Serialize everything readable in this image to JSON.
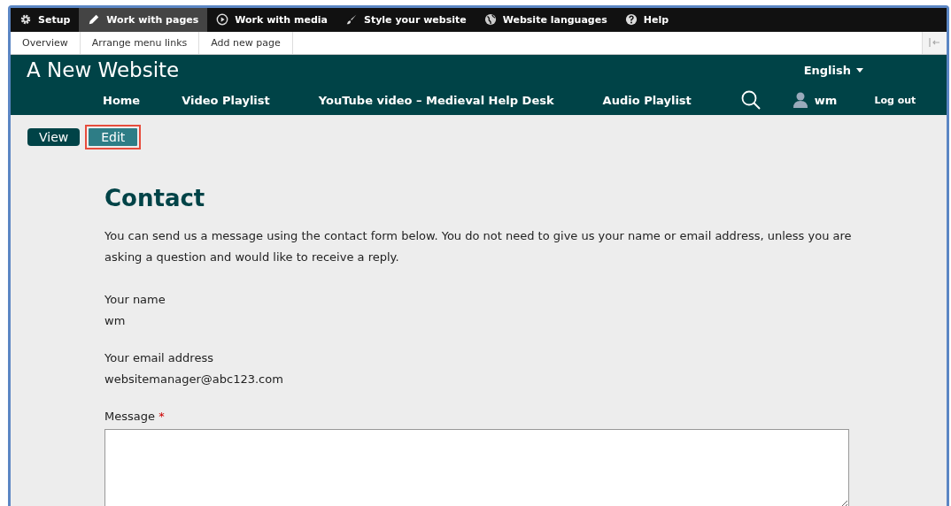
{
  "toolbar": {
    "items": [
      {
        "label": "Setup",
        "kind": "gear",
        "selected": false
      },
      {
        "label": "Work with pages",
        "kind": "pencil",
        "selected": true
      },
      {
        "label": "Work with media",
        "kind": "play",
        "selected": false
      },
      {
        "label": "Style your website",
        "kind": "brush",
        "selected": false
      },
      {
        "label": "Website languages",
        "kind": "globe",
        "selected": false
      },
      {
        "label": "Help",
        "kind": "help",
        "selected": false
      }
    ]
  },
  "subtoolbar": {
    "items": [
      "Overview",
      "Arrange menu links",
      "Add new page"
    ]
  },
  "header": {
    "site_name": "A New Website",
    "language": "English",
    "nav": [
      "Home",
      "Video Playlist",
      "YouTube video – Medieval Help Desk",
      "Audio Playlist"
    ],
    "user": "wm",
    "logout": "Log out"
  },
  "tabs": [
    {
      "label": "View",
      "selected": false,
      "highlighted": false
    },
    {
      "label": "Edit",
      "selected": true,
      "highlighted": true
    }
  ],
  "page": {
    "title": "Contact",
    "intro": "You can send us a message using the contact form below. You do not need to give us your name or email address, unless you are asking a question and would like to receive a reply.",
    "fields": [
      {
        "label": "Your name",
        "value": "wm"
      },
      {
        "label": "Your email address",
        "value": "websitemanager@abc123.com"
      }
    ],
    "message": {
      "label": "Message",
      "required_mark": "*"
    }
  }
}
